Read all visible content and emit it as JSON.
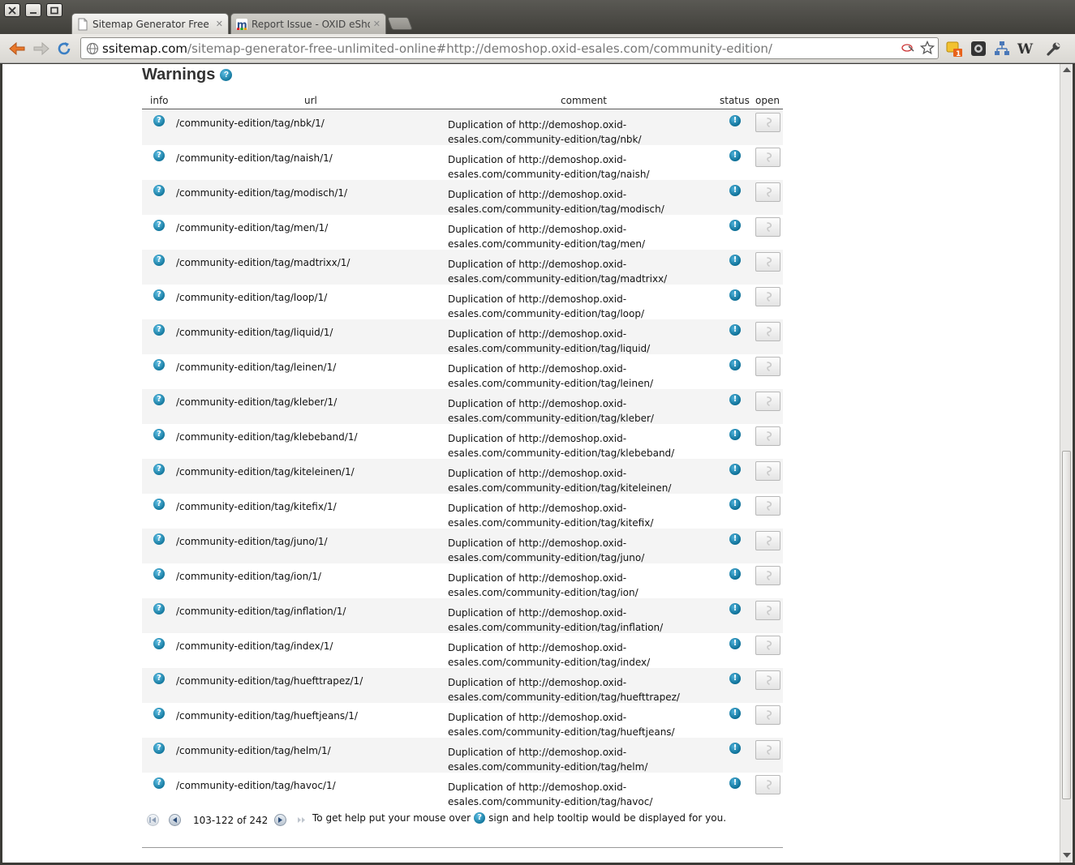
{
  "browser": {
    "tabs": [
      {
        "title": "Sitemap Generator Free O",
        "active": true
      },
      {
        "title": "Report Issue - OXID eShop",
        "active": false
      }
    ],
    "url_host": "ssitemap.com",
    "url_path": "/sitemap-generator-free-unlimited-online#http://demoshop.oxid-esales.com/community-edition/"
  },
  "page": {
    "section_title": "Warnings",
    "columns": {
      "info": "info",
      "url": "url",
      "comment": "comment",
      "status": "status",
      "open": "open"
    },
    "rows": [
      {
        "url": "/community-edition/tag/nbk/1/",
        "comment_line1": "Duplication of http://demoshop.oxid-",
        "comment_line2": "esales.com/community-edition/tag/nbk/"
      },
      {
        "url": "/community-edition/tag/naish/1/",
        "comment_line1": "Duplication of http://demoshop.oxid-",
        "comment_line2": "esales.com/community-edition/tag/naish/"
      },
      {
        "url": "/community-edition/tag/modisch/1/",
        "comment_line1": "Duplication of http://demoshop.oxid-",
        "comment_line2": "esales.com/community-edition/tag/modisch/"
      },
      {
        "url": "/community-edition/tag/men/1/",
        "comment_line1": "Duplication of http://demoshop.oxid-",
        "comment_line2": "esales.com/community-edition/tag/men/"
      },
      {
        "url": "/community-edition/tag/madtrixx/1/",
        "comment_line1": "Duplication of http://demoshop.oxid-",
        "comment_line2": "esales.com/community-edition/tag/madtrixx/"
      },
      {
        "url": "/community-edition/tag/loop/1/",
        "comment_line1": "Duplication of http://demoshop.oxid-",
        "comment_line2": "esales.com/community-edition/tag/loop/"
      },
      {
        "url": "/community-edition/tag/liquid/1/",
        "comment_line1": "Duplication of http://demoshop.oxid-",
        "comment_line2": "esales.com/community-edition/tag/liquid/"
      },
      {
        "url": "/community-edition/tag/leinen/1/",
        "comment_line1": "Duplication of http://demoshop.oxid-",
        "comment_line2": "esales.com/community-edition/tag/leinen/"
      },
      {
        "url": "/community-edition/tag/kleber/1/",
        "comment_line1": "Duplication of http://demoshop.oxid-",
        "comment_line2": "esales.com/community-edition/tag/kleber/"
      },
      {
        "url": "/community-edition/tag/klebeband/1/",
        "comment_line1": "Duplication of http://demoshop.oxid-",
        "comment_line2": "esales.com/community-edition/tag/klebeband/"
      },
      {
        "url": "/community-edition/tag/kiteleinen/1/",
        "comment_line1": "Duplication of http://demoshop.oxid-",
        "comment_line2": "esales.com/community-edition/tag/kiteleinen/"
      },
      {
        "url": "/community-edition/tag/kitefix/1/",
        "comment_line1": "Duplication of http://demoshop.oxid-",
        "comment_line2": "esales.com/community-edition/tag/kitefix/"
      },
      {
        "url": "/community-edition/tag/juno/1/",
        "comment_line1": "Duplication of http://demoshop.oxid-",
        "comment_line2": "esales.com/community-edition/tag/juno/"
      },
      {
        "url": "/community-edition/tag/ion/1/",
        "comment_line1": "Duplication of http://demoshop.oxid-",
        "comment_line2": "esales.com/community-edition/tag/ion/"
      },
      {
        "url": "/community-edition/tag/inflation/1/",
        "comment_line1": "Duplication of http://demoshop.oxid-",
        "comment_line2": "esales.com/community-edition/tag/inflation/"
      },
      {
        "url": "/community-edition/tag/index/1/",
        "comment_line1": "Duplication of http://demoshop.oxid-",
        "comment_line2": "esales.com/community-edition/tag/index/"
      },
      {
        "url": "/community-edition/tag/huefttrapez/1/",
        "comment_line1": "Duplication of http://demoshop.oxid-",
        "comment_line2": "esales.com/community-edition/tag/huefttrapez/"
      },
      {
        "url": "/community-edition/tag/hueftjeans/1/",
        "comment_line1": "Duplication of http://demoshop.oxid-",
        "comment_line2": "esales.com/community-edition/tag/hueftjeans/"
      },
      {
        "url": "/community-edition/tag/helm/1/",
        "comment_line1": "Duplication of http://demoshop.oxid-",
        "comment_line2": "esales.com/community-edition/tag/helm/"
      },
      {
        "url": "/community-edition/tag/havoc/1/",
        "comment_line1": "Duplication of http://demoshop.oxid-",
        "comment_line2": "esales.com/community-edition/tag/havoc/"
      }
    ],
    "pager": {
      "range": "103-122 of 242",
      "help_before": "To get help put your mouse over",
      "help_after": "sign and help tooltip would be displayed for you."
    }
  },
  "icons": {
    "info": "question-icon",
    "status": "exclamation-icon",
    "open": "open-link-icon"
  },
  "colors": {
    "accent": "#15799f",
    "row_alt": "#f4f4f4"
  }
}
